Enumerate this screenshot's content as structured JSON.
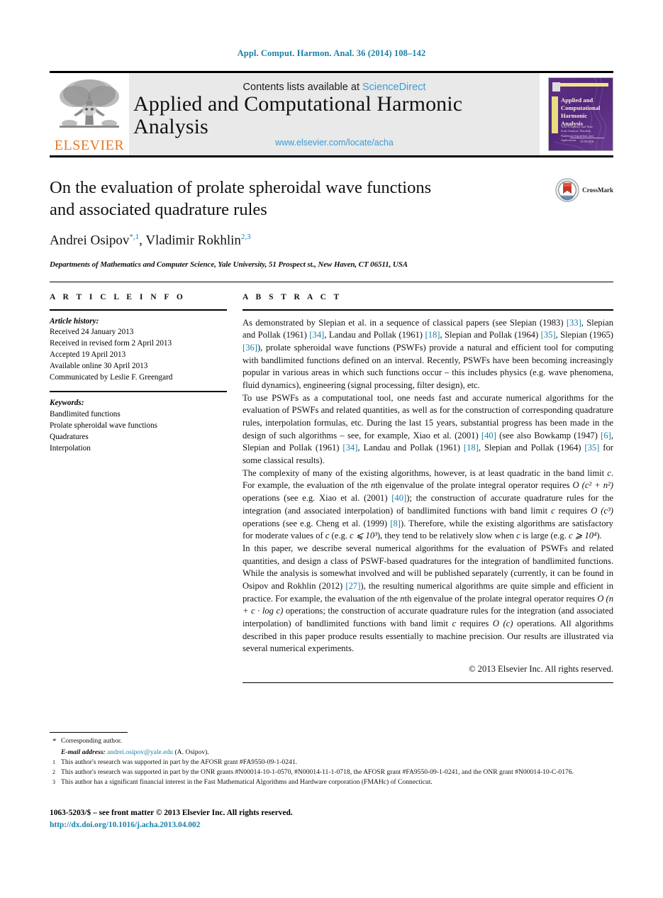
{
  "running_head": "Appl. Comput. Harmon. Anal. 36 (2014) 108–142",
  "masthead": {
    "publisher_name": "ELSEVIER",
    "publisher_logo_icon": "elsevier-tree-icon",
    "contents_prefix": "Contents lists available at ",
    "sciencedirect": "ScienceDirect",
    "journal_title": "Applied and Computational Harmonic Analysis",
    "journal_url": "www.elsevier.com/locate/acha",
    "cover": {
      "title": "Applied and Computational Harmonic Analysis",
      "subtitle": "Time-Frequency and Time-Scale Analysis, Wavelets, Numerical Algorithms, and Applications",
      "footer": "ELSEVIER"
    }
  },
  "article": {
    "title_line1": "On the evaluation of prolate spheroidal wave functions",
    "title_line2": "and associated quadrature rules",
    "authors": [
      {
        "name": "Andrei Osipov",
        "marks": "*,1"
      },
      {
        "name": "Vladimir Rokhlin",
        "marks": "2,3"
      }
    ],
    "affiliation": "Departments of Mathematics and Computer Science, Yale University, 51 Prospect st., New Haven, CT 06511, USA",
    "crossmark_label": "CrossMark"
  },
  "info": {
    "heading": "A R T I C L E   I N F O",
    "history_label": "Article history:",
    "history": [
      "Received 24 January 2013",
      "Received in revised form 2 April 2013",
      "Accepted 19 April 2013",
      "Available online 30 April 2013",
      "Communicated by Leslie F. Greengard"
    ],
    "keywords_label": "Keywords:",
    "keywords": [
      "Bandlimited functions",
      "Prolate spheroidal wave functions",
      "Quadratures",
      "Interpolation"
    ]
  },
  "abstract": {
    "heading": "A B S T R A C T",
    "p1_a": "As demonstrated by Slepian et al. in a sequence of classical papers (see Slepian (1983) ",
    "p1_r1": "[33]",
    "p1_b": ", Slepian and Pollak (1961) ",
    "p1_r2": "[34]",
    "p1_c": ", Landau and Pollak (1961) ",
    "p1_r3": "[18]",
    "p1_d": ", Slepian and Pollak (1964) ",
    "p1_r4": "[35]",
    "p1_e": ", Slepian (1965) ",
    "p1_r5": "[36]",
    "p1_f": "), prolate spheroidal wave functions (PSWFs) provide a natural and efficient tool for computing with bandlimited functions defined on an interval. Recently, PSWFs have been becoming increasingly popular in various areas in which such functions occur – this includes physics (e.g. wave phenomena, fluid dynamics), engineering (signal processing, filter design), etc.",
    "p2_a": "To use PSWFs as a computational tool, one needs fast and accurate numerical algorithms for the evaluation of PSWFs and related quantities, as well as for the construction of corresponding quadrature rules, interpolation formulas, etc. During the last 15 years, substantial progress has been made in the design of such algorithms – see, for example, Xiao et al. (2001) ",
    "p2_r1": "[40]",
    "p2_b": " (see also Bowkamp (1947) ",
    "p2_r2": "[6]",
    "p2_c": ", Slepian and Pollak (1961) ",
    "p2_r3": "[34]",
    "p2_d": ", Landau and Pollak (1961) ",
    "p2_r4": "[18]",
    "p2_e": ", Slepian and Pollak (1964) ",
    "p2_r5": "[35]",
    "p2_f": " for some classical results).",
    "p3_a": "The complexity of many of the existing algorithms, however, is at least quadratic in the band limit ",
    "p3_c1": "c",
    "p3_b": ". For example, the evaluation of the ",
    "p3_n1": "n",
    "p3_c2": "th eigenvalue of the prolate integral operator requires ",
    "p3_o1": "O (c² + n²)",
    "p3_d": " operations (see e.g. Xiao et al. (2001) ",
    "p3_r1": "[40]",
    "p3_e": "); the construction of accurate quadrature rules for the integration (and associated interpolation) of bandlimited functions with band limit ",
    "p3_c3": "c",
    "p3_f": " requires ",
    "p3_o2": "O (c³)",
    "p3_g": " operations (see e.g. Cheng et al. (1999) ",
    "p3_r2": "[8]",
    "p3_h": "). Therefore, while the existing algorithms are satisfactory for moderate values of ",
    "p3_c4": "c",
    "p3_i": " (e.g. ",
    "p3_c5": "c ⩽ 10³",
    "p3_j": "), they tend to be relatively slow when ",
    "p3_c6": "c",
    "p3_k": " is large (e.g. ",
    "p3_c7": "c ⩾ 10⁴",
    "p3_l": ").",
    "p4_a": "In this paper, we describe several numerical algorithms for the evaluation of PSWFs and related quantities, and design a class of PSWF-based quadratures for the integration of bandlimited functions. While the analysis is somewhat involved and will be published separately (currently, it can be found in Osipov and Rokhlin (2012) ",
    "p4_r1": "[27]",
    "p4_b": "), the resulting numerical algorithms are quite simple and efficient in practice. For example, the evaluation of the ",
    "p4_n1": "n",
    "p4_c": "th eigenvalue of the prolate integral operator requires ",
    "p4_o1": "O (n + c · log c)",
    "p4_d": " operations; the construction of accurate quadrature rules for the integration (and associated interpolation) of bandlimited functions with band limit ",
    "p4_c1": "c",
    "p4_e": " requires ",
    "p4_o2": "O (c)",
    "p4_f": " operations. All algorithms described in this paper produce results essentially to machine precision. Our results are illustrated via several numerical experiments.",
    "copyright": "© 2013 Elsevier Inc. All rights reserved."
  },
  "footnotes": {
    "corresponding_mark": "*",
    "corresponding": "Corresponding author.",
    "email_label": "E-mail address:",
    "email": "andrei.osipov@yale.edu",
    "email_suffix": " (A. Osipov).",
    "items": [
      {
        "mark": "1",
        "text": "This author's research was supported in part by the AFOSR grant #FA9550-09-1-0241."
      },
      {
        "mark": "2",
        "text": "This author's research was supported in part by the ONR grants #N00014-10-1-0570, #N00014-11-1-0718, the AFOSR grant #FA9550-09-1-0241, and the ONR grant #N00014-10-C-0176."
      },
      {
        "mark": "3",
        "text": "This author has a significant financial interest in the Fast Mathematical Algorithms and Hardware corporation (FMAHc) of Connecticut."
      }
    ]
  },
  "footer": {
    "issn": "1063-5203/$ – see front matter  © 2013 Elsevier Inc. All rights reserved.",
    "doi": "http://dx.doi.org/10.1016/j.acha.2013.04.002"
  },
  "colors": {
    "link": "#1a7fa8",
    "sciencedirect": "#3b9cd6",
    "elsevier_orange": "#e87722",
    "cover_purple": "#5b2d82"
  }
}
